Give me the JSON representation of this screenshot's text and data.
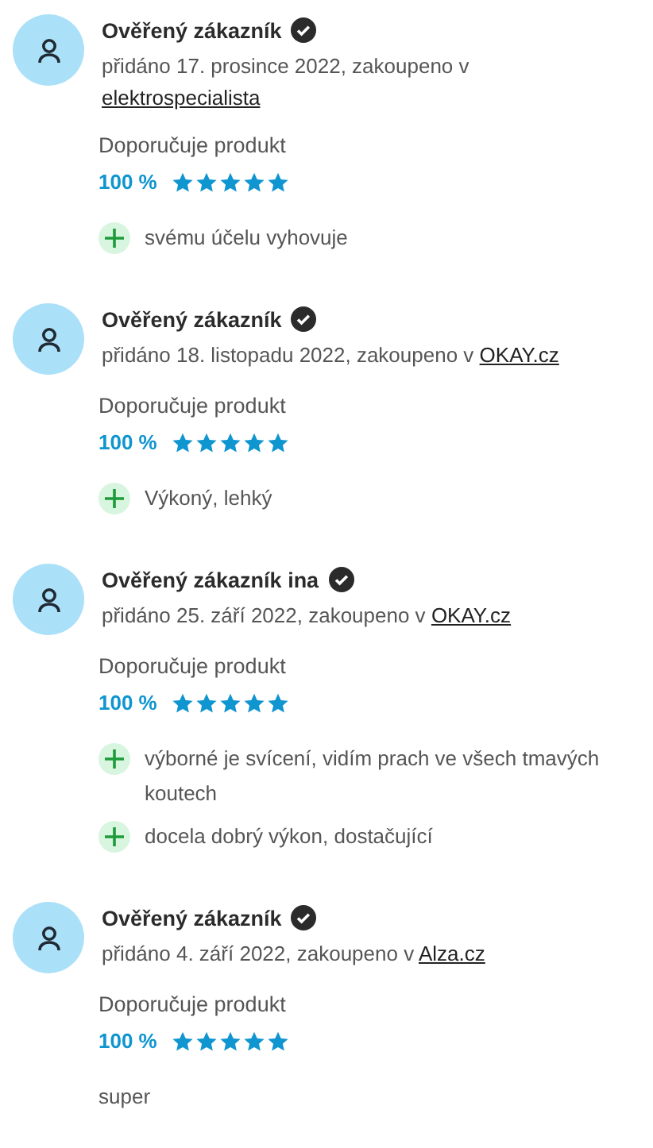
{
  "reviews": [
    {
      "author": "Ověřený zákazník",
      "verified": true,
      "added": "přidáno 17. prosince 2022, zakoupeno v",
      "store": "elektrospecialista",
      "recommend_label": "Doporučuje produkt",
      "recommend_value": "100 %",
      "stars": 5,
      "pros": [
        "svému účelu vyhovuje"
      ]
    },
    {
      "author": "Ověřený zákazník",
      "verified": true,
      "added": "přidáno 18. listopadu 2022, zakoupeno v",
      "store": "OKAY.cz",
      "recommend_label": "Doporučuje produkt",
      "recommend_value": "100 %",
      "stars": 5,
      "pros": [
        "Výkoný, lehký"
      ]
    },
    {
      "author": "Ověřený zákazník ina",
      "verified": true,
      "added": "přidáno 25. září 2022, zakoupeno v",
      "store": "OKAY.cz",
      "recommend_label": "Doporučuje produkt",
      "recommend_value": "100 %",
      "stars": 5,
      "pros": [
        "výborné je svícení, vidím prach ve všech tmavých koutech",
        "docela dobrý výkon, dostačující"
      ]
    },
    {
      "author": "Ověřený zákazník",
      "verified": true,
      "added": "přidáno 4. září 2022, zakoupeno v",
      "store": "Alza.cz",
      "recommend_label": "Doporučuje produkt",
      "recommend_value": "100 %",
      "stars": 5,
      "comment": "super"
    }
  ]
}
